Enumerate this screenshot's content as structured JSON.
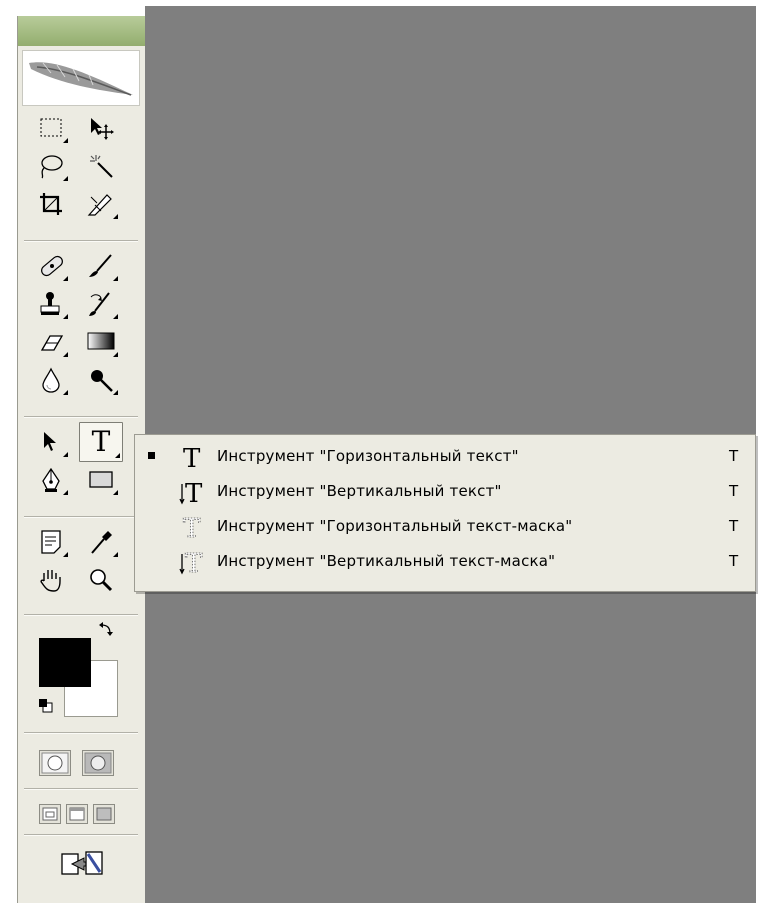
{
  "toolbox": {
    "tools": [
      {
        "name": "marquee-tool-icon"
      },
      {
        "name": "move-tool-icon"
      },
      {
        "name": "lasso-tool-icon"
      },
      {
        "name": "magic-wand-tool-icon"
      },
      {
        "name": "crop-tool-icon"
      },
      {
        "name": "slice-tool-icon"
      },
      {
        "name": "healing-brush-tool-icon"
      },
      {
        "name": "brush-tool-icon"
      },
      {
        "name": "clone-stamp-tool-icon"
      },
      {
        "name": "history-brush-tool-icon"
      },
      {
        "name": "eraser-tool-icon"
      },
      {
        "name": "gradient-tool-icon"
      },
      {
        "name": "blur-tool-icon"
      },
      {
        "name": "dodge-tool-icon"
      },
      {
        "name": "path-selection-tool-icon"
      },
      {
        "name": "type-tool-icon",
        "selected": true,
        "glyph": "T"
      },
      {
        "name": "pen-tool-icon"
      },
      {
        "name": "rectangle-tool-icon"
      },
      {
        "name": "notes-tool-icon"
      },
      {
        "name": "eyedropper-tool-icon"
      },
      {
        "name": "hand-tool-icon"
      },
      {
        "name": "zoom-tool-icon"
      }
    ],
    "foreground_color": "#000000",
    "background_color": "#ffffff"
  },
  "flyout": {
    "items": [
      {
        "label": "Инструмент \"Горизонтальный текст\"",
        "shortcut": "T",
        "active": true,
        "icon": "horizontal-type-icon"
      },
      {
        "label": "Инструмент \"Вертикальный текст\"",
        "shortcut": "T",
        "active": false,
        "icon": "vertical-type-icon"
      },
      {
        "label": "Инструмент \"Горизонтальный текст-маска\"",
        "shortcut": "T",
        "active": false,
        "icon": "horizontal-type-mask-icon"
      },
      {
        "label": "Инструмент \"Вертикальный текст-маска\"",
        "shortcut": "T",
        "active": false,
        "icon": "vertical-type-mask-icon"
      }
    ]
  },
  "colors": {
    "workspace": "#7f7f7f",
    "panel": "#ecebe2",
    "grip": "#a3bb80"
  }
}
